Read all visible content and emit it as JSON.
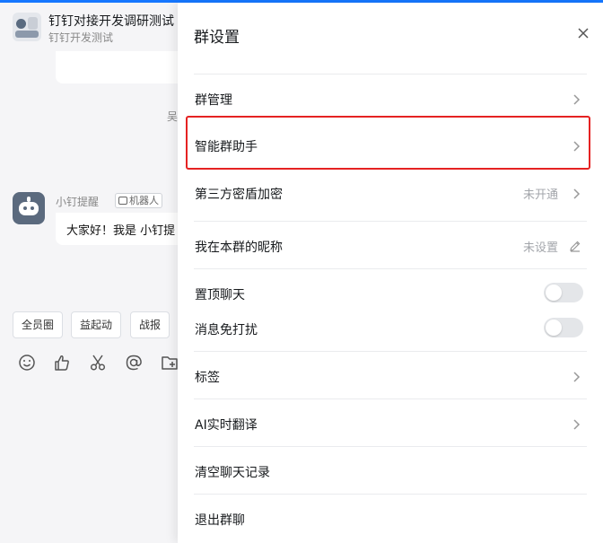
{
  "chat": {
    "group_name": "钉钉对接开发调研测试",
    "group_subtitle": "钉钉开发测试",
    "system_text_fragment": "吴",
    "sender_name": "小钉提醒",
    "robot_tag": "机器人",
    "bot_message": "大家好！我是 小钉提",
    "quick_buttons": [
      "全员圈",
      "益起动",
      "战报"
    ],
    "toolbar_icons": [
      "emoji-icon",
      "thumbs-up-icon",
      "scissors-icon",
      "at-icon",
      "folder-add-icon"
    ]
  },
  "panel": {
    "title": "群设置",
    "rows": {
      "group_manage": "群管理",
      "smart_assistant": "智能群助手",
      "encryption": {
        "label": "第三方密盾加密",
        "value": "未开通"
      },
      "nickname": {
        "label": "我在本群的昵称",
        "value": "未设置"
      },
      "pin_chat": "置顶聊天",
      "mute": "消息免打扰",
      "tags": "标签",
      "ai_translate": "AI实时翻译",
      "clear_history": "清空聊天记录",
      "leave_group": "退出群聊"
    },
    "toggles": {
      "pin_chat": false,
      "mute": false
    }
  },
  "colors": {
    "accent": "#1677ff",
    "highlight": "#e52222",
    "panel_bg": "#ffffff",
    "chat_bg": "#f5f5f7"
  }
}
